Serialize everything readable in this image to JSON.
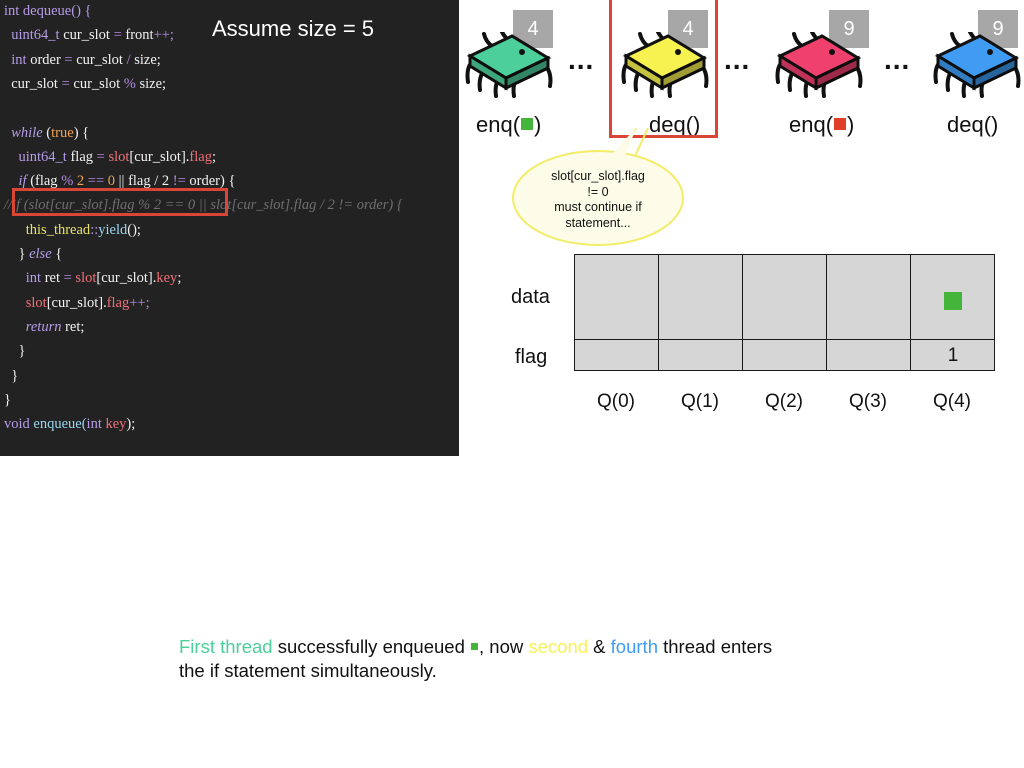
{
  "colors": {
    "green": "#4ccf9b",
    "yellow": "#f7f250",
    "pink": "#f0406e",
    "blue": "#3f9cf2",
    "marker_green": "#45b43b",
    "marker_red": "#e0402a",
    "highlight_red": "#d94537"
  },
  "code": {
    "size_note": "Assume size = 5",
    "lines": [
      {
        "tokens": [
          {
            "t": "int dequeue() {",
            "c": "kw"
          }
        ]
      },
      {
        "tokens": [
          {
            "t": "  uint64_t",
            "c": "kw"
          },
          {
            "t": " cur_slot ",
            "c": "plain"
          },
          {
            "t": "=",
            "c": "op"
          },
          {
            "t": " front",
            "c": "plain"
          },
          {
            "t": "++;",
            "c": "op"
          }
        ]
      },
      {
        "tokens": [
          {
            "t": "  int",
            "c": "kw"
          },
          {
            "t": " order ",
            "c": "plain"
          },
          {
            "t": "=",
            "c": "op"
          },
          {
            "t": " cur_slot ",
            "c": "plain"
          },
          {
            "t": "/",
            "c": "op"
          },
          {
            "t": " size;",
            "c": "plain"
          }
        ]
      },
      {
        "tokens": [
          {
            "t": "  cur_slot ",
            "c": "plain"
          },
          {
            "t": "=",
            "c": "op"
          },
          {
            "t": " cur_slot ",
            "c": "plain"
          },
          {
            "t": "%",
            "c": "op"
          },
          {
            "t": " size;",
            "c": "plain"
          }
        ]
      },
      {
        "tokens": []
      },
      {
        "tokens": [
          {
            "t": "  while",
            "c": "kw ital"
          },
          {
            "t": " (",
            "c": "plain"
          },
          {
            "t": "true",
            "c": "orange"
          },
          {
            "t": ") {",
            "c": "plain"
          }
        ]
      },
      {
        "tokens": [
          {
            "t": "    uint64_t",
            "c": "kw"
          },
          {
            "t": " flag ",
            "c": "plain"
          },
          {
            "t": "=",
            "c": "op"
          },
          {
            "t": " slot",
            "c": "red"
          },
          {
            "t": "[cur_slot].",
            "c": "plain"
          },
          {
            "t": "flag",
            "c": "red"
          },
          {
            "t": ";",
            "c": "plain"
          }
        ]
      },
      {
        "tokens": [
          {
            "t": "    if",
            "c": "kw ital"
          },
          {
            "t": " (flag ",
            "c": "plain"
          },
          {
            "t": "%",
            "c": "op"
          },
          {
            "t": " 2 ",
            "c": "orange"
          },
          {
            "t": "==",
            "c": "op"
          },
          {
            "t": " 0 ",
            "c": "orange"
          },
          {
            "t": "|| flag / 2 ",
            "c": "plain"
          },
          {
            "t": "!=",
            "c": "op"
          },
          {
            "t": " order) {",
            "c": "plain"
          }
        ]
      },
      {
        "tokens": [
          {
            "t": "//if (slot[cur_slot].flag % 2 == 0 || slot[cur_slot].flag / 2 != order) {",
            "c": "comment"
          }
        ]
      },
      {
        "tokens": [
          {
            "t": "      this_thread",
            "c": "yellow"
          },
          {
            "t": "::",
            "c": "op"
          },
          {
            "t": "yield",
            "c": "cyan"
          },
          {
            "t": "();",
            "c": "plain"
          }
        ]
      },
      {
        "tokens": [
          {
            "t": "    } ",
            "c": "plain"
          },
          {
            "t": "else",
            "c": "kw ital"
          },
          {
            "t": " {",
            "c": "plain"
          }
        ]
      },
      {
        "tokens": [
          {
            "t": "      int",
            "c": "kw"
          },
          {
            "t": " ret ",
            "c": "plain"
          },
          {
            "t": "=",
            "c": "op"
          },
          {
            "t": " slot",
            "c": "red"
          },
          {
            "t": "[cur_slot].",
            "c": "plain"
          },
          {
            "t": "key",
            "c": "red"
          },
          {
            "t": ";",
            "c": "plain"
          }
        ]
      },
      {
        "tokens": [
          {
            "t": "      slot",
            "c": "red"
          },
          {
            "t": "[cur_slot].",
            "c": "plain"
          },
          {
            "t": "flag",
            "c": "red"
          },
          {
            "t": "++;",
            "c": "op"
          }
        ]
      },
      {
        "tokens": [
          {
            "t": "      return",
            "c": "kw ital"
          },
          {
            "t": " ret;",
            "c": "plain"
          }
        ]
      },
      {
        "tokens": [
          {
            "t": "    }",
            "c": "plain"
          }
        ]
      },
      {
        "tokens": [
          {
            "t": "  }",
            "c": "plain"
          }
        ]
      },
      {
        "tokens": [
          {
            "t": "}",
            "c": "plain"
          }
        ]
      },
      {
        "tokens": [
          {
            "t": "void",
            "c": "kw"
          },
          {
            "t": " enqueue(",
            "c": "cyan"
          },
          {
            "t": "int",
            "c": "kw"
          },
          {
            "t": " key",
            "c": "red"
          },
          {
            "t": ");",
            "c": "plain"
          }
        ]
      }
    ]
  },
  "threads": [
    {
      "badge": "4",
      "color": "green",
      "op": "enq(",
      "op_end": ")",
      "marker": "marker_green"
    },
    {
      "badge": "4",
      "color": "yellow",
      "op": "deq()",
      "op_end": "",
      "marker": ""
    },
    {
      "badge": "9",
      "color": "pink",
      "op": "enq(",
      "op_end": ")",
      "marker": "marker_red"
    },
    {
      "badge": "9",
      "color": "blue",
      "op": "deq()",
      "op_end": "",
      "marker": ""
    }
  ],
  "ellipsis": "...",
  "bubble": {
    "lines": [
      "slot[cur_slot].flag",
      "!= 0",
      "must continue if",
      "statement..."
    ]
  },
  "queue": {
    "row_labels": {
      "data": "data",
      "flag": "flag"
    },
    "columns": [
      "Q(0)",
      "Q(1)",
      "Q(2)",
      "Q(3)",
      "Q(4)"
    ],
    "flags": [
      "",
      "",
      "",
      "",
      "1"
    ],
    "data_marker_index": 4,
    "data_marker_color": "marker_green"
  },
  "caption": {
    "part1": "First thread",
    "part2": " successfully enqueued ",
    "part3": ", now ",
    "part4": "second",
    "part5": " & ",
    "part6": "fourth",
    "part7": " thread enters",
    "line2": "the if statement simultaneously."
  }
}
